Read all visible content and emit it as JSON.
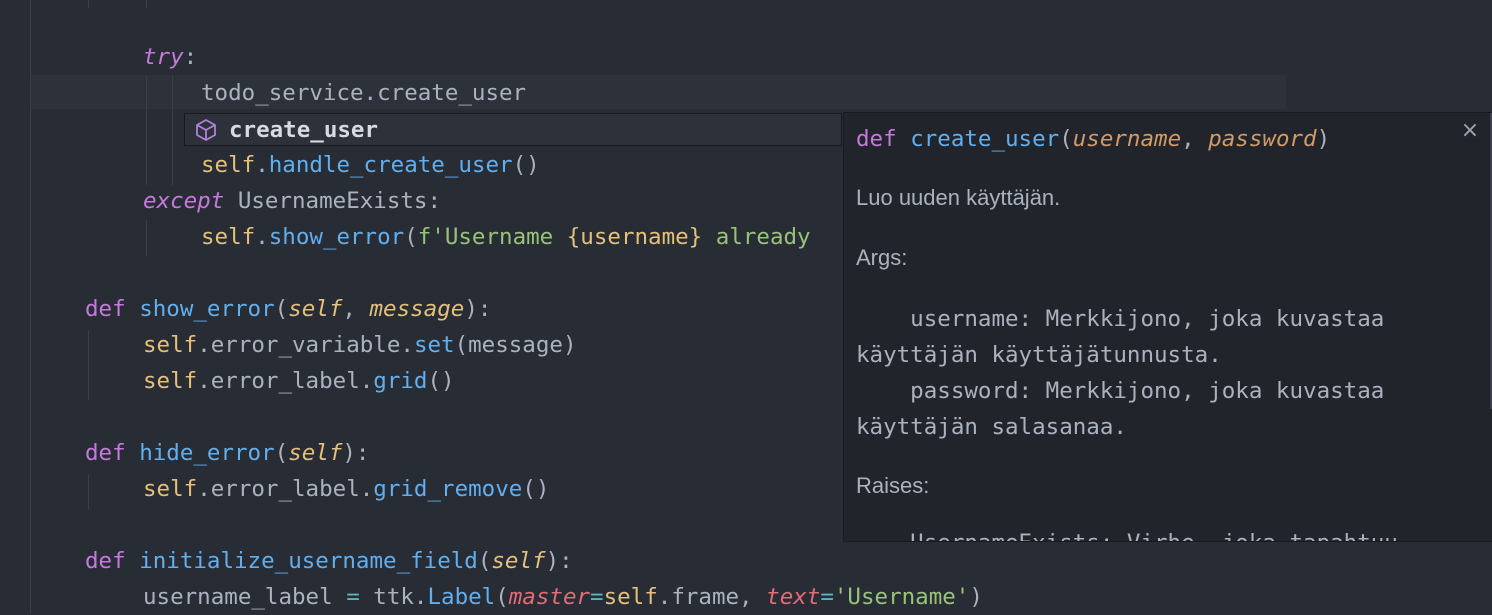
{
  "editor": {
    "lines": {
      "try_kw": "try",
      "colon": ":",
      "todo_call": "todo_service.create_user",
      "self": "self",
      "dot": ".",
      "handle_create_user": "handle_create_user",
      "parens": "()",
      "except_kw": "except",
      "username_exists": "UsernameExists:",
      "show_error": "show_error",
      "fstring_prefix": "f'Username ",
      "fstring_interp": "{username}",
      "fstring_rest": " already",
      "open_paren": "(",
      "def_kw": "def",
      "comma_space": ", ",
      "message": "message",
      "close_colon": "):",
      "error_variable": "error_variable",
      "set": "set",
      "message_arg": "(message)",
      "error_label": "error_label",
      "grid": "grid",
      "hide_error": "hide_error",
      "grid_remove": "grid_remove",
      "initialize_username_field": "initialize_username_field",
      "username_label": "username_label",
      "assign": " = ",
      "ttk_label": "ttk.",
      "label_cls": "Label",
      "master_kw": "master",
      "eq": "=",
      "frame": ".frame, ",
      "text_kw": "text",
      "username_str": "'Username'",
      "close_paren": ")"
    }
  },
  "suggest": {
    "icon": "cube-icon",
    "label": "create_user"
  },
  "docs": {
    "sig_def": "def",
    "sig_name": "create_user",
    "sig_open": "(",
    "sig_p1": "username",
    "sig_sep": ", ",
    "sig_p2": "password",
    "sig_close": ")",
    "summary": "Luo uuden käyttäjän.",
    "args_heading": "Args:",
    "arg_username_1": "    username: Merkkijono, joka kuvastaa",
    "arg_username_2": "käyttäjän käyttäjätunnusta.",
    "arg_password_1": "    password: Merkkijono, joka kuvastaa",
    "arg_password_2": "käyttäjän salasanaa.",
    "raises_heading": "Raises:",
    "raises_partial": "    UsernameExists: Virhe, joka tapahtuu",
    "close_icon": "close-icon",
    "close_glyph": "×"
  },
  "colors": {
    "background": "#282c34",
    "keyword": "#c678dd",
    "function": "#61afef",
    "self": "#e5c07b",
    "param": "#e06c75",
    "string": "#98c379"
  }
}
